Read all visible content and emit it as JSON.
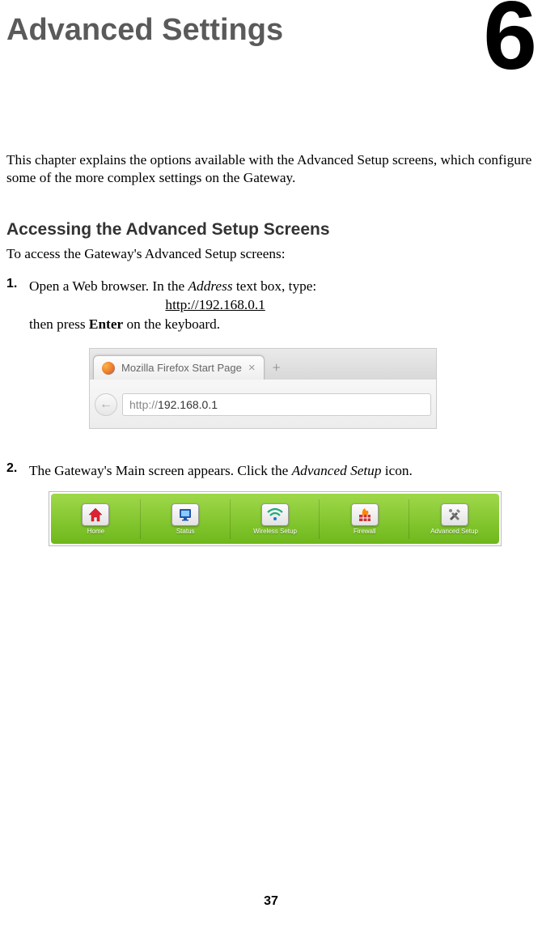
{
  "chapter": {
    "title": "Advanced Settings",
    "number": "6"
  },
  "intro": "This chapter explains the options available with the Advanced Setup screens, which configure some of the more complex settings on the Gateway.",
  "section": {
    "heading": "Accessing the Advanced Setup Screens",
    "sub": "To access the Gateway's Advanced Setup screens:"
  },
  "steps": {
    "s1": {
      "num": "1.",
      "part1": "Open a Web browser. In the ",
      "address_word": "Address",
      "part2": " text box, type:",
      "url": "http://192.168.0.1",
      "part3a": "then press ",
      "enter_word": "Enter",
      "part3b": " on the keyboard."
    },
    "s2": {
      "num": "2.",
      "part1": "The Gateway's Main screen appears. Click the ",
      "advsetup_word": "Advanced Setup",
      "part2": " icon."
    }
  },
  "browser": {
    "tab_title": "Mozilla Firefox Start Page",
    "tab_close": "×",
    "tab_plus": "+",
    "nav_back_glyph": "←",
    "addr_prefix": "http://",
    "addr_host": "192.168.0.1"
  },
  "navbar": {
    "items": [
      {
        "label": "Home"
      },
      {
        "label": "Status"
      },
      {
        "label": "Wireless Setup"
      },
      {
        "label": "Firewall"
      },
      {
        "label": "Advanced Setup"
      }
    ]
  },
  "page_number": "37"
}
